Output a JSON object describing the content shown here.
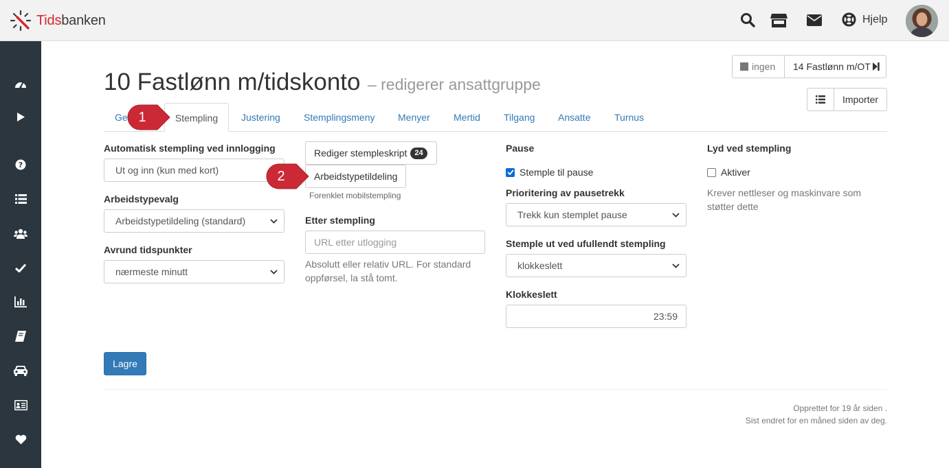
{
  "app": {
    "brand_part1": "Tids",
    "brand_part2": "banken"
  },
  "header": {
    "help_label": "Hjelp"
  },
  "nav": {
    "prev_label": "ingen",
    "next_label": "14 Fastlønn m/OT",
    "import_label": "Importer"
  },
  "page": {
    "title": "10 Fastlønn m/tidskonto",
    "subtitle": "– redigerer ansattgruppe"
  },
  "tabs": [
    {
      "label": "Ge"
    },
    {
      "label": "Stempling"
    },
    {
      "label": "Justering"
    },
    {
      "label": "Stemplingsmeny"
    },
    {
      "label": "Menyer"
    },
    {
      "label": "Mertid"
    },
    {
      "label": "Tilgang"
    },
    {
      "label": "Ansatte"
    },
    {
      "label": "Turnus"
    }
  ],
  "form": {
    "auto_stamp_label": "Automatisk stempling ved innlogging",
    "auto_stamp_value": "Ut og inn (kun med kort)",
    "worktype_label": "Arbeidstypevalg",
    "worktype_value": "Arbeidstypetildeling (standard)",
    "round_label": "Avrund tidspunkter",
    "round_value": "nærmeste minutt",
    "edit_script_label": "Rediger stempleskript",
    "edit_script_count": "24",
    "worktype_assign_label": "Arbeidstypetildeling",
    "simplified_mobile": "Forenklet mobilstempling",
    "after_stamp_label": "Etter stempling",
    "after_stamp_placeholder": "URL etter utlogging",
    "after_stamp_help": "Absolutt eller relativ URL. For standard oppførsel, la stå tomt.",
    "pause_label": "Pause",
    "pause_checkbox_label": "Stemple til pause",
    "pause_checked": true,
    "pause_priority_label": "Prioritering av pausetrekk",
    "pause_priority_value": "Trekk kun stemplet pause",
    "stamp_out_label": "Stemple ut ved ufullendt stempling",
    "stamp_out_value": "klokkeslett",
    "clock_label": "Klokkeslett",
    "clock_value": "23:59",
    "sound_label": "Lyd ved stempling",
    "sound_checkbox_label": "Aktiver",
    "sound_checked": false,
    "sound_help": "Krever nettleser og maskinvare som støtter dette",
    "save_label": "Lagre"
  },
  "footer": {
    "created": "Opprettet for 19 år siden .",
    "changed": "Sist endret for en måned siden av deg."
  },
  "annotations": [
    {
      "number": "1"
    },
    {
      "number": "2"
    }
  ],
  "colors": {
    "brand_red": "#d8262e",
    "sidebar": "#2b363f",
    "link": "#337ab7",
    "primary": "#337ab7",
    "annotation": "#cc2936"
  },
  "icons": {
    "sidebar": [
      "dashboard-icon",
      "play-icon",
      "question-icon",
      "list-icon",
      "users-icon",
      "check-icon",
      "bar-chart-icon",
      "book-icon",
      "car-icon",
      "id-card-icon",
      "heart-icon"
    ],
    "header": [
      "search-icon",
      "store-icon",
      "envelope-icon",
      "lifebuoy-icon"
    ]
  }
}
